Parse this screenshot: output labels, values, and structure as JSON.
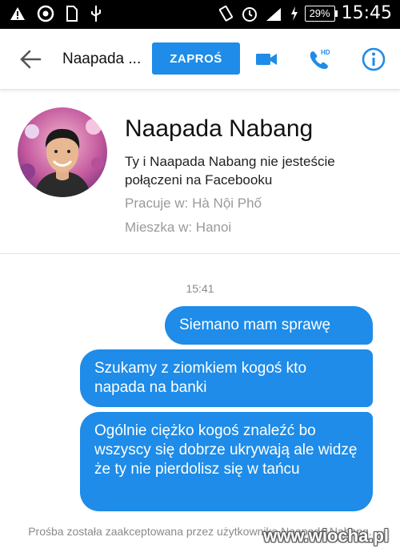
{
  "status_bar": {
    "battery": "29%",
    "time": "15:45",
    "icons": [
      "warning-icon",
      "chrome-icon",
      "sim-icon",
      "usb-icon",
      "vibrate-icon",
      "alarm-icon",
      "signal-icon",
      "charging-icon"
    ]
  },
  "header": {
    "title": "Naapada ...",
    "invite_label": "ZAPROŚ",
    "icons": [
      "back-arrow-icon",
      "video-call-icon",
      "hd-call-icon",
      "info-icon"
    ],
    "accent_color": "#1e8ce8"
  },
  "profile": {
    "name": "Naapada Nabang",
    "not_friends": "Ty i Naapada Nabang nie jesteście połączeni na Facebooku",
    "work": "Pracuje w: Hà Nội Phố",
    "lives": "Mieszka w: Hanoi"
  },
  "conversation": {
    "timestamp": "15:41",
    "messages": [
      {
        "text": "Siemano mam sprawę"
      },
      {
        "text": "Szukamy z ziomkiem kogoś kto napada na banki"
      },
      {
        "text": "Ogólnie ciężko kogoś znaleźć bo wszyscy się dobrze ukrywają ale widzę że ty nie pierdolisz się w tańcu"
      }
    ],
    "accepted_note": "Prośba została zaakceptowana przez użytkownika Naapada Nabang.",
    "bubble_color": "#1e8ce8"
  },
  "watermark": "www.wiocha.pl"
}
